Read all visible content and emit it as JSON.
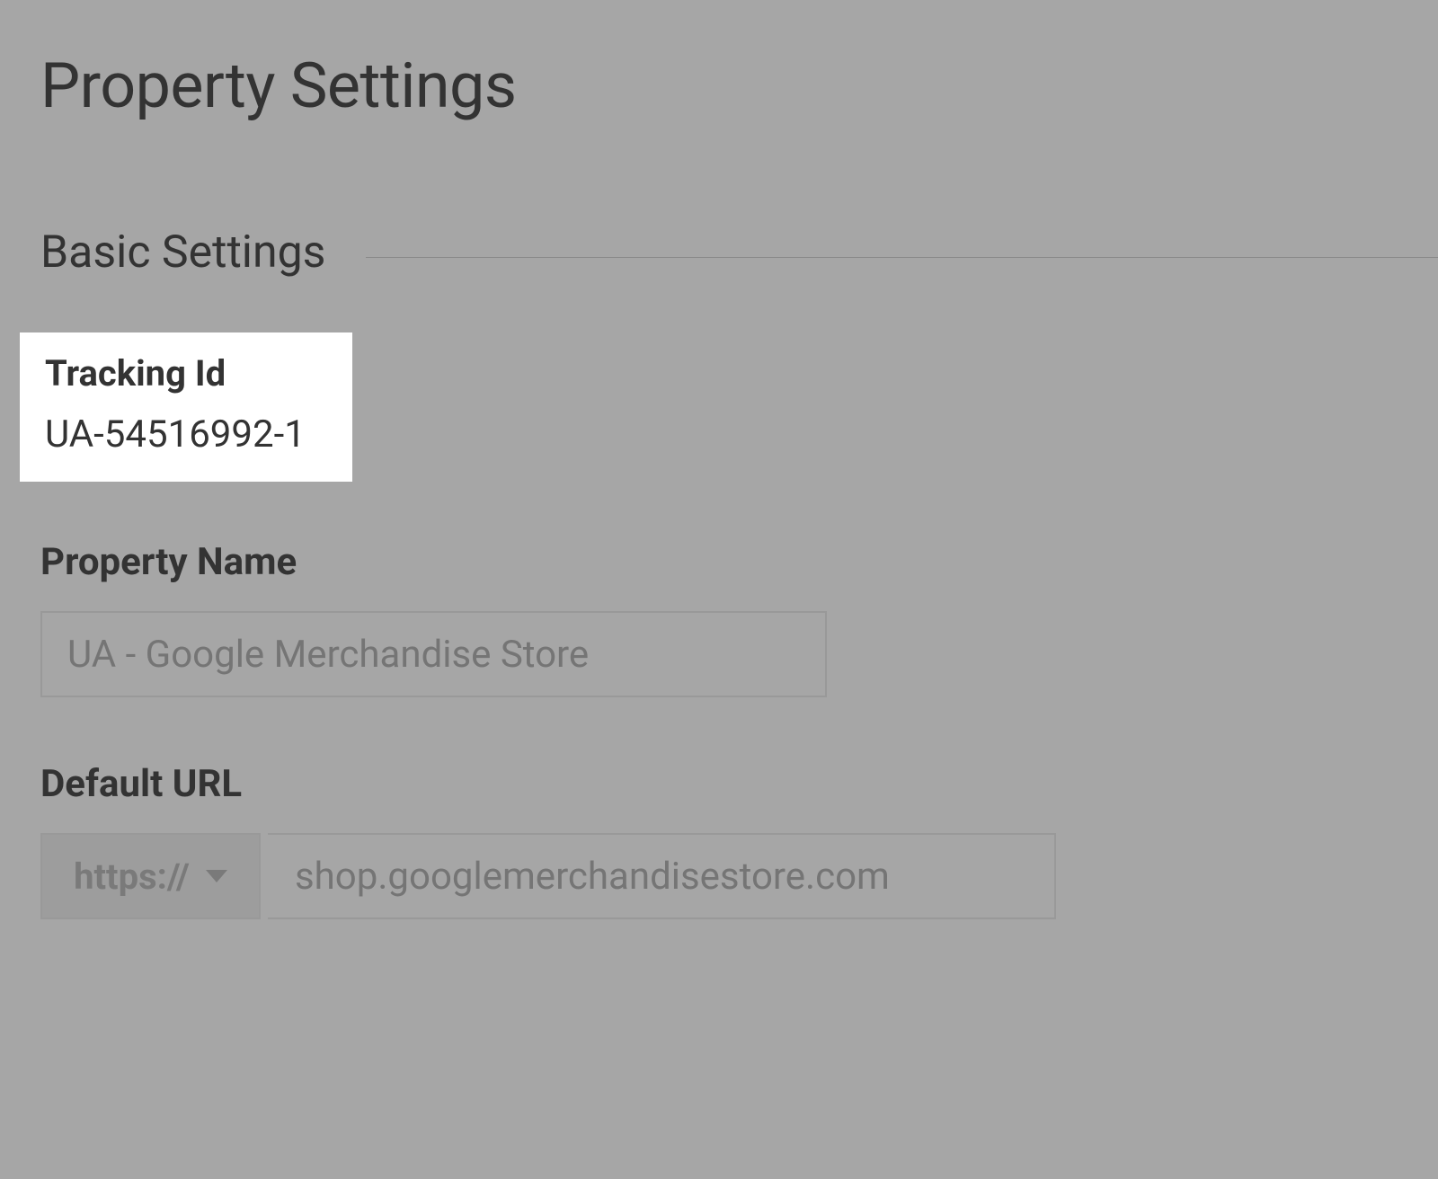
{
  "page": {
    "title": "Property Settings"
  },
  "section": {
    "title": "Basic Settings"
  },
  "tracking": {
    "label": "Tracking Id",
    "value": "UA-54516992-1"
  },
  "propertyName": {
    "label": "Property Name",
    "value": "UA - Google Merchandise Store"
  },
  "defaultUrl": {
    "label": "Default URL",
    "protocol": "https://",
    "value": "shop.googlemerchandisestore.com"
  }
}
